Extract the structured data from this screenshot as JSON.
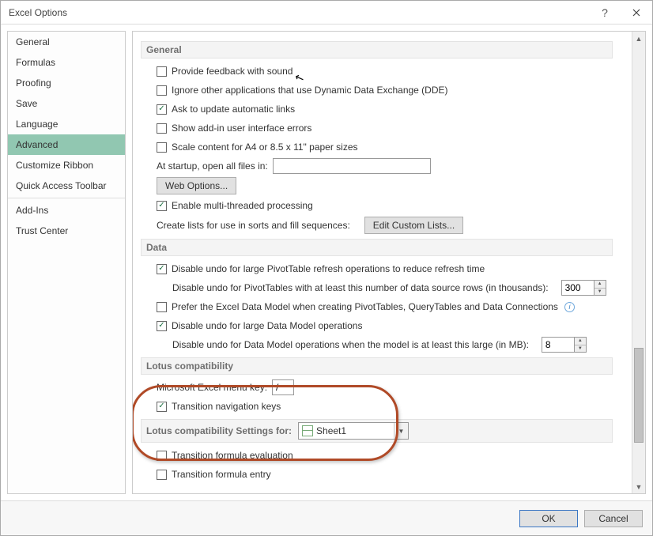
{
  "window": {
    "title": "Excel Options"
  },
  "sidebar": [
    {
      "label": "General"
    },
    {
      "label": "Formulas"
    },
    {
      "label": "Proofing"
    },
    {
      "label": "Save"
    },
    {
      "label": "Language"
    },
    {
      "label": "Advanced"
    },
    {
      "label": "Customize Ribbon"
    },
    {
      "label": "Quick Access Toolbar"
    },
    {
      "label": "Add-Ins"
    },
    {
      "label": "Trust Center"
    }
  ],
  "general": {
    "header": "General",
    "feedback_sound": "Provide feedback with sound",
    "ignore_dde": "Ignore other applications that use Dynamic Data Exchange (DDE)",
    "ask_update_links": "Ask to update automatic links",
    "show_addin_errors": "Show add-in user interface errors",
    "scale_paper": "Scale content for A4 or 8.5 x 11\" paper sizes",
    "startup_open_label": "At startup, open all files in:",
    "startup_open_value": "",
    "web_options_btn": "Web Options...",
    "multi_threaded": "Enable multi-threaded processing",
    "create_lists_label": "Create lists for use in sorts and fill sequences:",
    "edit_custom_lists_btn": "Edit Custom Lists..."
  },
  "data": {
    "header": "Data",
    "disable_undo_pivot_refresh": "Disable undo for large PivotTable refresh operations to reduce refresh time",
    "disable_undo_pivot_rows_label": "Disable undo for PivotTables with at least this number of data source rows (in thousands):",
    "disable_undo_pivot_rows_value": "300",
    "prefer_data_model": "Prefer the Excel Data Model when creating PivotTables, QueryTables and Data Connections",
    "disable_undo_data_model": "Disable undo for large Data Model operations",
    "disable_undo_data_model_mb_label": "Disable undo for Data Model operations when the model is at least this large (in MB):",
    "disable_undo_data_model_mb_value": "8"
  },
  "lotus": {
    "header": "Lotus compatibility",
    "menu_key_label": "Microsoft Excel menu key:",
    "menu_key_value": "/",
    "transition_nav_keys": "Transition navigation keys"
  },
  "lotus_settings": {
    "header_label": "Lotus compatibility Settings for:",
    "sheet_value": "Sheet1",
    "transition_formula_eval": "Transition formula evaluation",
    "transition_formula_entry": "Transition formula entry"
  },
  "footer": {
    "ok": "OK",
    "cancel": "Cancel"
  }
}
